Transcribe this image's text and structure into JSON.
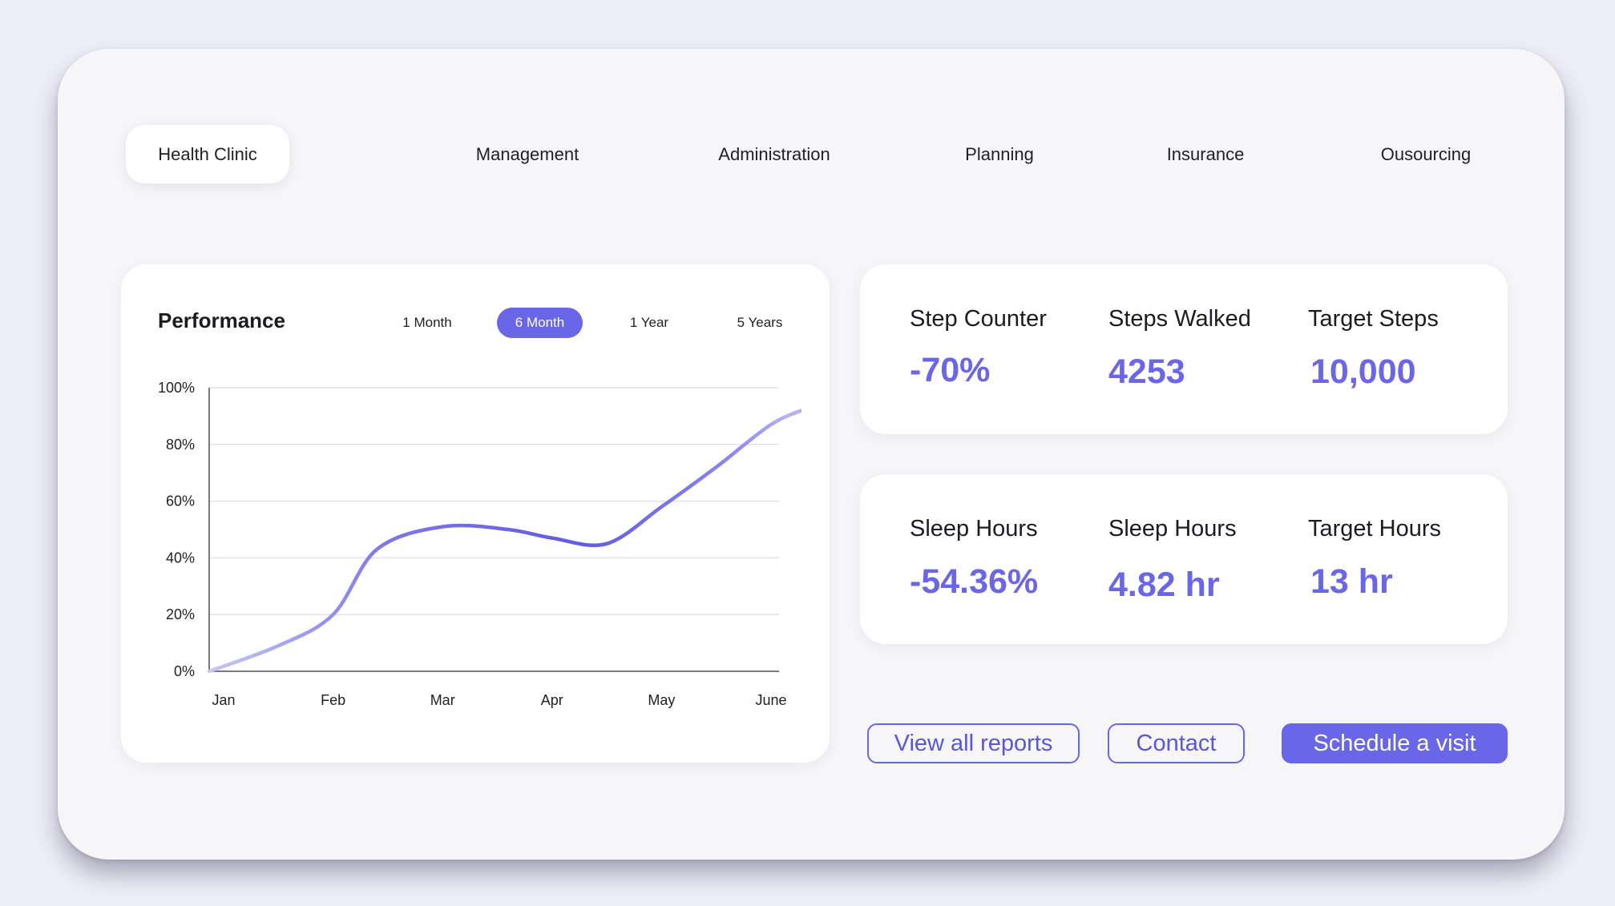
{
  "nav": {
    "items": [
      {
        "label": "Health Clinic",
        "active": true
      },
      {
        "label": "Management"
      },
      {
        "label": "Administration"
      },
      {
        "label": "Planning"
      },
      {
        "label": "Insurance"
      },
      {
        "label": "Ousourcing"
      }
    ]
  },
  "performance": {
    "title": "Performance",
    "ranges": [
      "1 Month",
      "6 Month",
      "1 Year",
      "5 Years"
    ],
    "selected_range": "6 Month"
  },
  "chart_data": {
    "type": "line",
    "title": "Performance",
    "categories": [
      "Jan",
      "Feb",
      "Mar",
      "Apr",
      "May",
      "June"
    ],
    "y_ticks": [
      "0%",
      "20%",
      "40%",
      "60%",
      "80%",
      "100%"
    ],
    "ylim": [
      0,
      100
    ],
    "grid": true,
    "series": [
      {
        "x": [
          0,
          0.5,
          1,
          1.4,
          2,
          2.6,
          3,
          3.5,
          4,
          4.5,
          5,
          5.35
        ],
        "values": [
          0,
          9,
          20,
          43,
          51,
          50,
          47,
          45,
          58,
          72,
          87,
          93
        ]
      }
    ],
    "color": "#6a66e8"
  },
  "steps_card": {
    "stats": [
      {
        "label": "Step Counter",
        "value": "-70%"
      },
      {
        "label": "Steps Walked",
        "value": "4253"
      },
      {
        "label": "Target Steps",
        "value": "10,000"
      }
    ]
  },
  "sleep_card": {
    "stats": [
      {
        "label": "Sleep Hours",
        "value": "-54.36%"
      },
      {
        "label": "Sleep Hours",
        "value": "4.82 hr"
      },
      {
        "label": "Target Hours",
        "value": "13 hr"
      }
    ]
  },
  "actions": {
    "view_reports": "View all reports",
    "contact": "Contact",
    "schedule": "Schedule a visit"
  },
  "colors": {
    "accent": "#6a66e8",
    "background": "#eeeef8",
    "panel": "#f6f6f9",
    "card": "#ffffff"
  }
}
